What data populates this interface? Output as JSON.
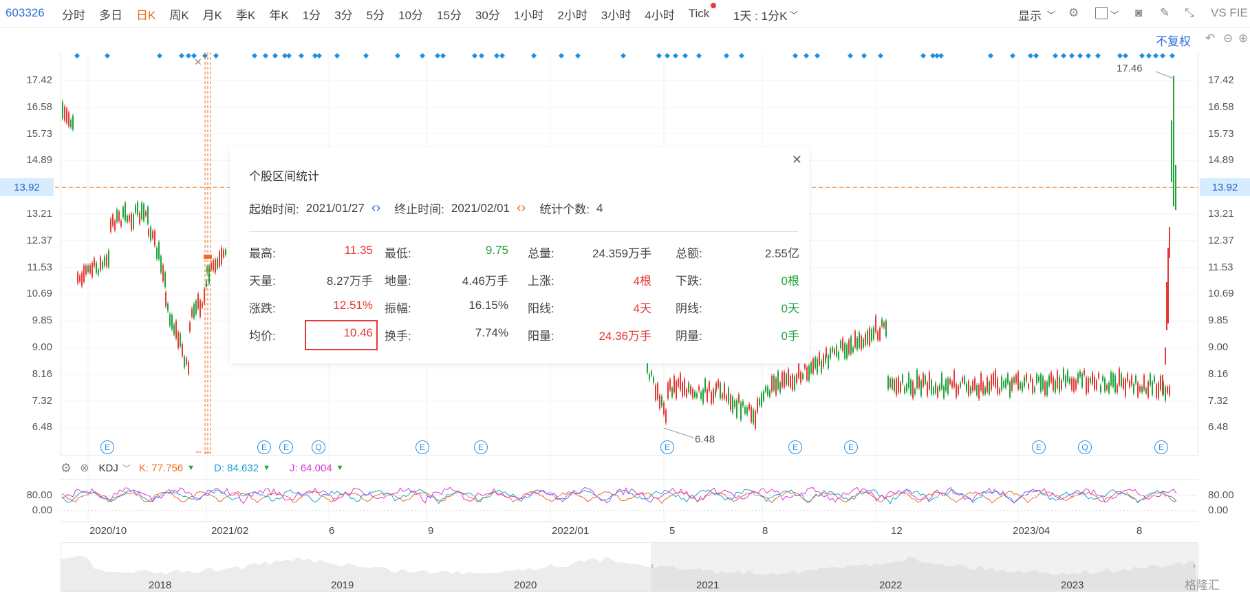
{
  "toolbar": {
    "stock_code": "603326",
    "periods": [
      "分时",
      "多日",
      "日K",
      "周K",
      "月K",
      "季K",
      "年K",
      "1分",
      "3分",
      "5分",
      "10分",
      "15分",
      "30分",
      "1小时",
      "2小时",
      "3小时",
      "4小时",
      "Tick"
    ],
    "active_period": "日K",
    "compare_label": "1天 : 1分K",
    "display_label": "显示",
    "vs_label": "VS FIE"
  },
  "adjust_label": "不复权",
  "y_axis": {
    "ticks": [
      "17.42",
      "16.58",
      "15.73",
      "14.89",
      "13.92",
      "13.21",
      "12.37",
      "11.53",
      "10.69",
      "9.85",
      "9.00",
      "8.16",
      "7.32",
      "6.48"
    ],
    "highlight_price": "13.92",
    "high_marker": "17.46",
    "low_marker": "6.48"
  },
  "stats_panel": {
    "title": "个股区间统计",
    "start_label": "起始时间:",
    "start_date": "2021/01/27",
    "end_label": "终止时间:",
    "end_date": "2021/02/01",
    "count_label": "统计个数:",
    "count": "4",
    "rows": [
      [
        {
          "label": "最高:",
          "value": "11.35",
          "color": "red"
        },
        {
          "label": "最低:",
          "value": "9.75",
          "color": "green"
        },
        {
          "label": "总量:",
          "value": "24.359万手",
          "color": "blk"
        },
        {
          "label": "总额:",
          "value": "2.55亿",
          "color": "blk"
        }
      ],
      [
        {
          "label": "天量:",
          "value": "8.27万手",
          "color": "blk"
        },
        {
          "label": "地量:",
          "value": "4.46万手",
          "color": "blk"
        },
        {
          "label": "上涨:",
          "value": "4根",
          "color": "red"
        },
        {
          "label": "下跌:",
          "value": "0根",
          "color": "green"
        }
      ],
      [
        {
          "label": "涨跌:",
          "value": "12.51%",
          "color": "red"
        },
        {
          "label": "振幅:",
          "value": "16.15%",
          "color": "blk"
        },
        {
          "label": "阳线:",
          "value": "4天",
          "color": "red"
        },
        {
          "label": "阴线:",
          "value": "0天",
          "color": "green"
        }
      ],
      [
        {
          "label": "均价:",
          "value": "10.46",
          "color": "red"
        },
        {
          "label": "换手:",
          "value": "7.74%",
          "color": "blk"
        },
        {
          "label": "阳量:",
          "value": "24.36万手",
          "color": "red"
        },
        {
          "label": "阴量:",
          "value": "0手",
          "color": "green"
        }
      ]
    ]
  },
  "kdj": {
    "name": "KDJ",
    "k_label": "K: 77.756",
    "d_label": "D: 84.632",
    "j_label": "J: 64.004",
    "ticks": [
      "80.00",
      "0.00"
    ]
  },
  "x_axis": [
    "2020/10",
    "2021/02",
    "6",
    "9",
    "2022/01",
    "5",
    "8",
    "12",
    "2023/04",
    "8"
  ],
  "navigator_years": [
    "2018",
    "2019",
    "2020",
    "2021",
    "2022",
    "2023"
  ],
  "event_markers": [
    "E",
    "E",
    "E",
    "Q",
    "E",
    "E",
    "E",
    "E",
    "E",
    "E",
    "Q",
    "E"
  ],
  "watermark": "格隆汇",
  "colors": {
    "up": "#e53935",
    "down": "#1fa33a",
    "accent": "#ef6b1e",
    "blue": "#2b6fd6"
  }
}
